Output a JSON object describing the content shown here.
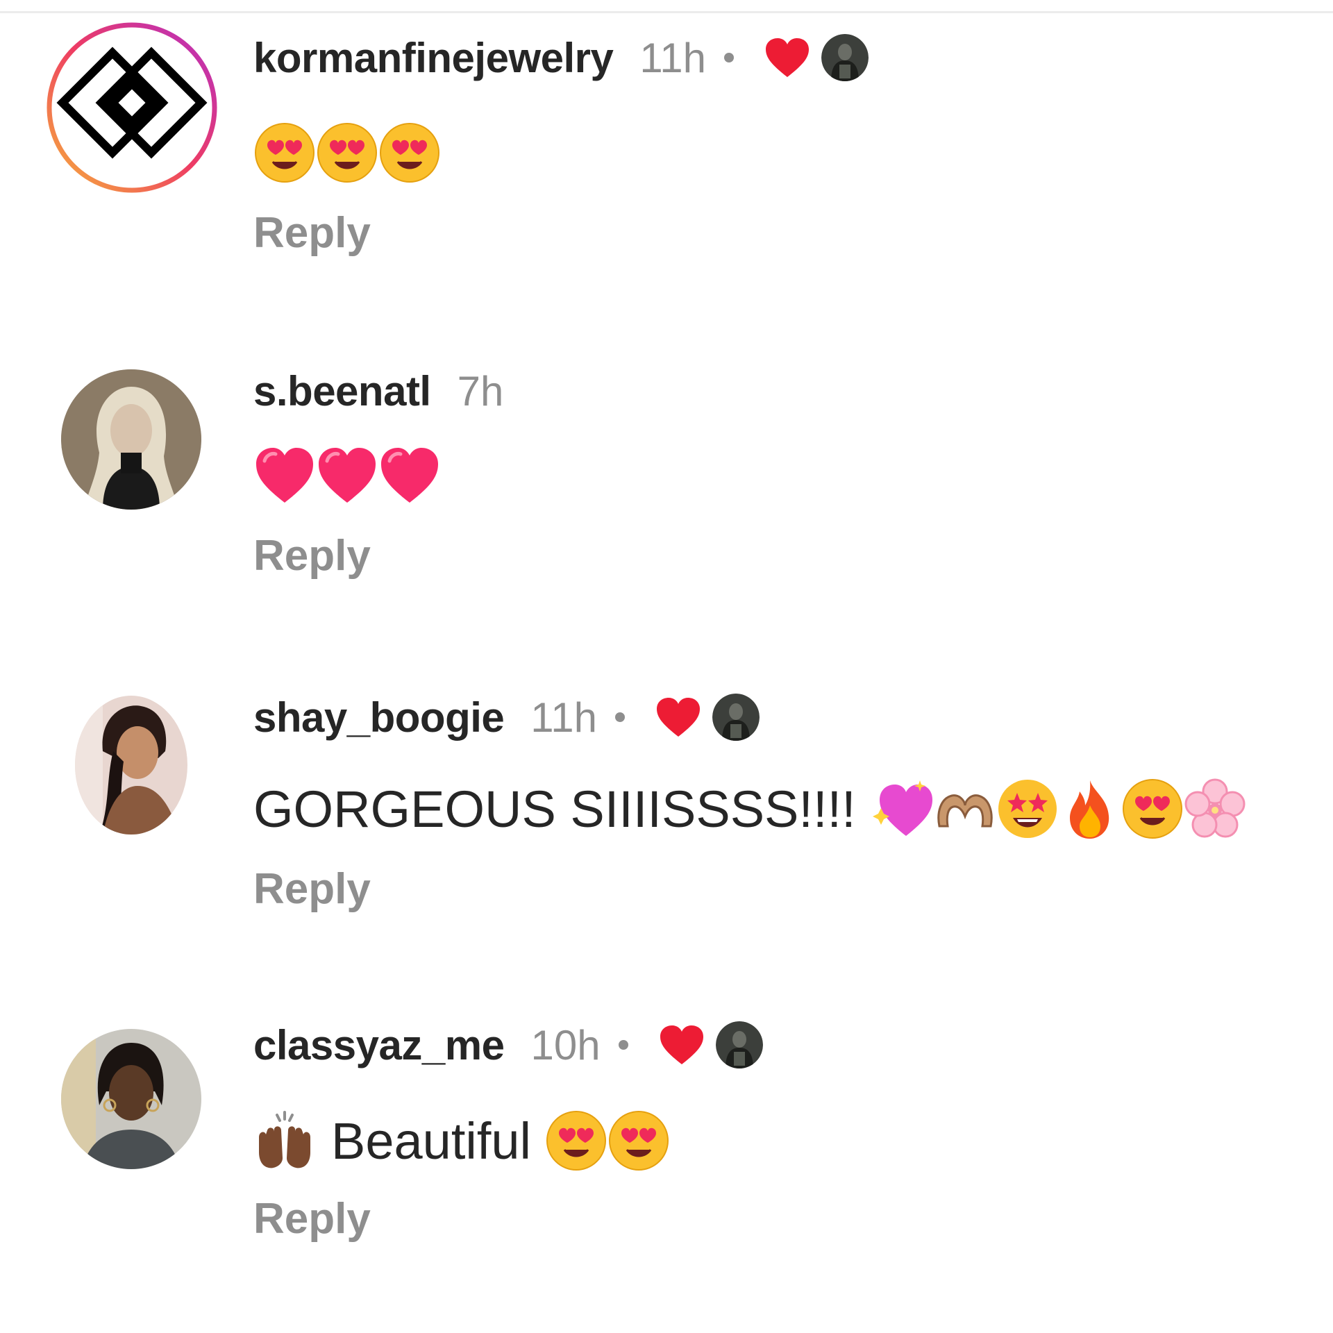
{
  "comments": [
    {
      "username": "kormanfinejewelry",
      "time": "11h",
      "liked_by_author": true,
      "text": "",
      "emojis": [
        "heart-eyes-face",
        "heart-eyes-face",
        "heart-eyes-face"
      ],
      "reply_label": "Reply"
    },
    {
      "username": "s.beenatl",
      "time": "7h",
      "liked_by_author": false,
      "text": "",
      "emojis": [
        "pink-heart",
        "pink-heart",
        "pink-heart"
      ],
      "reply_label": "Reply"
    },
    {
      "username": "shay_boogie",
      "time": "11h",
      "liked_by_author": true,
      "text": "GORGEOUS SIIIISSSS!!!!",
      "emojis": [
        "sparkling-heart",
        "heart-hands",
        "star-struck-face",
        "fire",
        "heart-eyes-face",
        "cherry-blossom"
      ],
      "reply_label": "Reply"
    },
    {
      "username": "classyaz_me",
      "time": "10h",
      "liked_by_author": true,
      "text": "Beautiful",
      "leading_emoji": "raising-hands",
      "emojis": [
        "heart-eyes-face",
        "heart-eyes-face"
      ],
      "reply_label": "Reply"
    }
  ],
  "colors": {
    "like_red": "#ed1c34",
    "muted_text": "#8e8e8e",
    "primary_text": "#262626"
  }
}
